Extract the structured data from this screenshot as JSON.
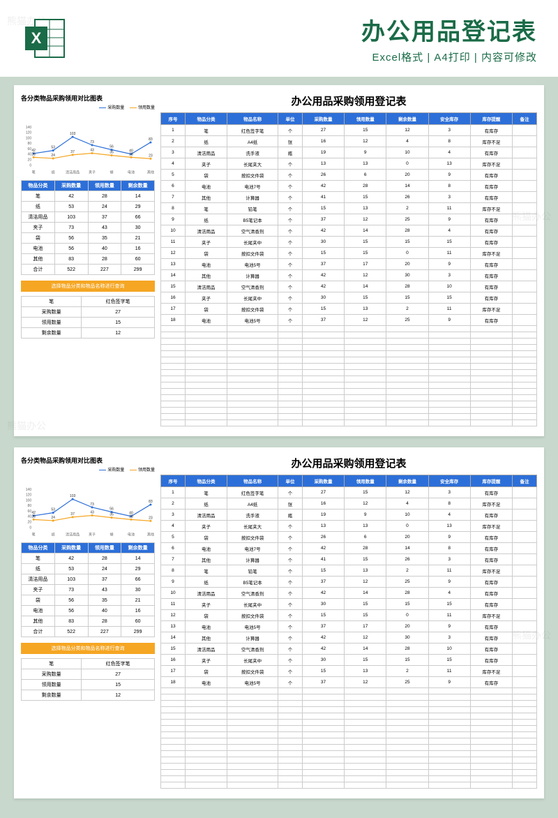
{
  "header": {
    "title": "办公用品登记表",
    "subtitle": "Excel格式 | A4打印 | 内容可修改"
  },
  "chart_data": {
    "type": "line",
    "title": "各分类物品采购领用对比图表",
    "categories": [
      "笔",
      "纸",
      "清洁用品",
      "夹子",
      "袋",
      "电池",
      "其他"
    ],
    "series": [
      {
        "name": "采购数量",
        "values": [
          42,
          53,
          103,
          73,
          56,
          40,
          83
        ],
        "color": "#2d6fd8"
      },
      {
        "name": "领用数量",
        "values": [
          28,
          24,
          37,
          43,
          35,
          28,
          23
        ],
        "color": "#f5a623"
      }
    ],
    "ylim": [
      0,
      140
    ],
    "ticks": [
      0,
      20,
      40,
      60,
      80,
      100,
      120,
      140
    ]
  },
  "summary": {
    "headers": [
      "物品分类",
      "采购数量",
      "领用数量",
      "剩余数量"
    ],
    "rows": [
      [
        "笔",
        "42",
        "28",
        "14"
      ],
      [
        "纸",
        "53",
        "24",
        "29"
      ],
      [
        "清洁用品",
        "103",
        "37",
        "66"
      ],
      [
        "夹子",
        "73",
        "43",
        "30"
      ],
      [
        "袋",
        "56",
        "35",
        "21"
      ],
      [
        "电池",
        "56",
        "40",
        "16"
      ],
      [
        "其他",
        "83",
        "28",
        "60"
      ],
      [
        "合计",
        "522",
        "227",
        "299"
      ]
    ]
  },
  "lookup": {
    "title": "选择物品分类和物品名称进行查询",
    "rows": [
      [
        "笔",
        "红色签字笔"
      ],
      [
        "采购数量",
        "27"
      ],
      [
        "领用数量",
        "15"
      ],
      [
        "剩余数量",
        "12"
      ]
    ]
  },
  "main": {
    "title": "办公用品采购领用登记表",
    "headers": [
      "序号",
      "物品分类",
      "物品名称",
      "单位",
      "采购数量",
      "领用数量",
      "剩余数量",
      "安全库存",
      "库存提醒",
      "备注"
    ],
    "rows": [
      [
        "1",
        "笔",
        "红色签字笔",
        "个",
        "27",
        "15",
        "12",
        "3",
        "有库存",
        ""
      ],
      [
        "2",
        "纸",
        "A4纸",
        "张",
        "16",
        "12",
        "4",
        "8",
        "库存不足",
        ""
      ],
      [
        "3",
        "清洁用品",
        "洗手液",
        "瓶",
        "19",
        "9",
        "10",
        "4",
        "有库存",
        ""
      ],
      [
        "4",
        "夹子",
        "长尾夹大",
        "个",
        "13",
        "13",
        "0",
        "13",
        "库存不足",
        ""
      ],
      [
        "5",
        "袋",
        "按扣文件袋",
        "个",
        "26",
        "6",
        "20",
        "9",
        "有库存",
        ""
      ],
      [
        "6",
        "电池",
        "电池7号",
        "个",
        "42",
        "28",
        "14",
        "8",
        "有库存",
        ""
      ],
      [
        "7",
        "其他",
        "计算器",
        "个",
        "41",
        "15",
        "26",
        "3",
        "有库存",
        ""
      ],
      [
        "8",
        "笔",
        "铅笔",
        "个",
        "15",
        "13",
        "2",
        "11",
        "库存不足",
        ""
      ],
      [
        "9",
        "纸",
        "B5笔记本",
        "个",
        "37",
        "12",
        "25",
        "9",
        "有库存",
        ""
      ],
      [
        "10",
        "清洁用品",
        "空气清香剂",
        "个",
        "42",
        "14",
        "28",
        "4",
        "有库存",
        ""
      ],
      [
        "11",
        "夹子",
        "长尾夹中",
        "个",
        "30",
        "15",
        "15",
        "15",
        "有库存",
        ""
      ],
      [
        "12",
        "袋",
        "按扣文件袋",
        "个",
        "15",
        "15",
        "0",
        "11",
        "库存不足",
        ""
      ],
      [
        "13",
        "电池",
        "电池5号",
        "个",
        "37",
        "17",
        "20",
        "9",
        "有库存",
        ""
      ],
      [
        "14",
        "其他",
        "计算器",
        "个",
        "42",
        "12",
        "30",
        "3",
        "有库存",
        ""
      ],
      [
        "15",
        "清洁用品",
        "空气清香剂",
        "个",
        "42",
        "14",
        "28",
        "10",
        "有库存",
        ""
      ],
      [
        "16",
        "夹子",
        "长尾夹中",
        "个",
        "30",
        "15",
        "15",
        "15",
        "有库存",
        ""
      ],
      [
        "17",
        "袋",
        "按扣文件袋",
        "个",
        "15",
        "13",
        "2",
        "11",
        "库存不足",
        ""
      ],
      [
        "18",
        "电池",
        "电池5号",
        "个",
        "37",
        "12",
        "25",
        "9",
        "有库存",
        ""
      ]
    ],
    "empty_rows": 16
  }
}
